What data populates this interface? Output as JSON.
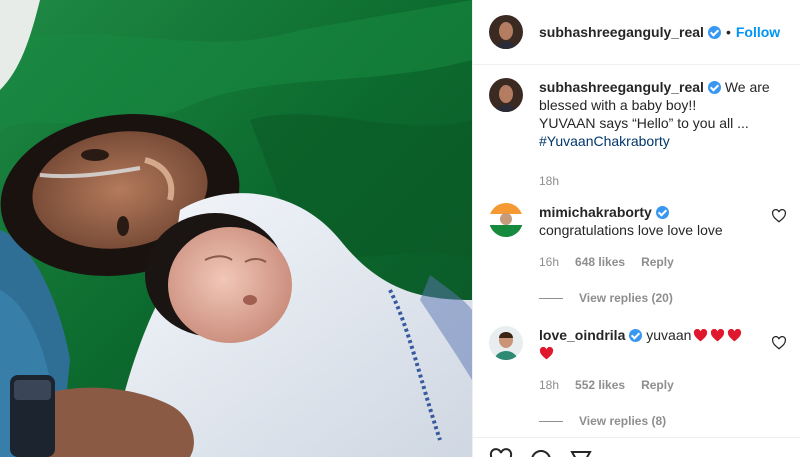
{
  "post": {
    "author": "subhashreeganguly_real",
    "dot": "•",
    "follow_label": "Follow",
    "caption_lines": [
      "We are",
      "blessed with a baby boy!!",
      "YUVAAN says “Hello” to you all ..."
    ],
    "hashtag": "#YuvaanChakraborty",
    "time": "18h"
  },
  "comments": [
    {
      "user": "mimichakraborty",
      "verified": true,
      "text": "congratulations love love love",
      "time": "16h",
      "likes": "648 likes",
      "reply_label": "Reply",
      "view_replies": "View replies (20)"
    },
    {
      "user": "love_oindrila",
      "verified": true,
      "text": "yuvaan",
      "time": "18h",
      "likes": "552 likes",
      "reply_label": "Reply",
      "view_replies": "View replies (8)"
    }
  ],
  "icons": {
    "verified": "verified-badge-icon",
    "like": "heart-outline-icon",
    "emoji_heart": "red-heart-emoji"
  },
  "colors": {
    "accent": "#0095f6",
    "verified": "#3897f0",
    "heart": "#e0182d",
    "drape_green": "#0f6a2c"
  }
}
